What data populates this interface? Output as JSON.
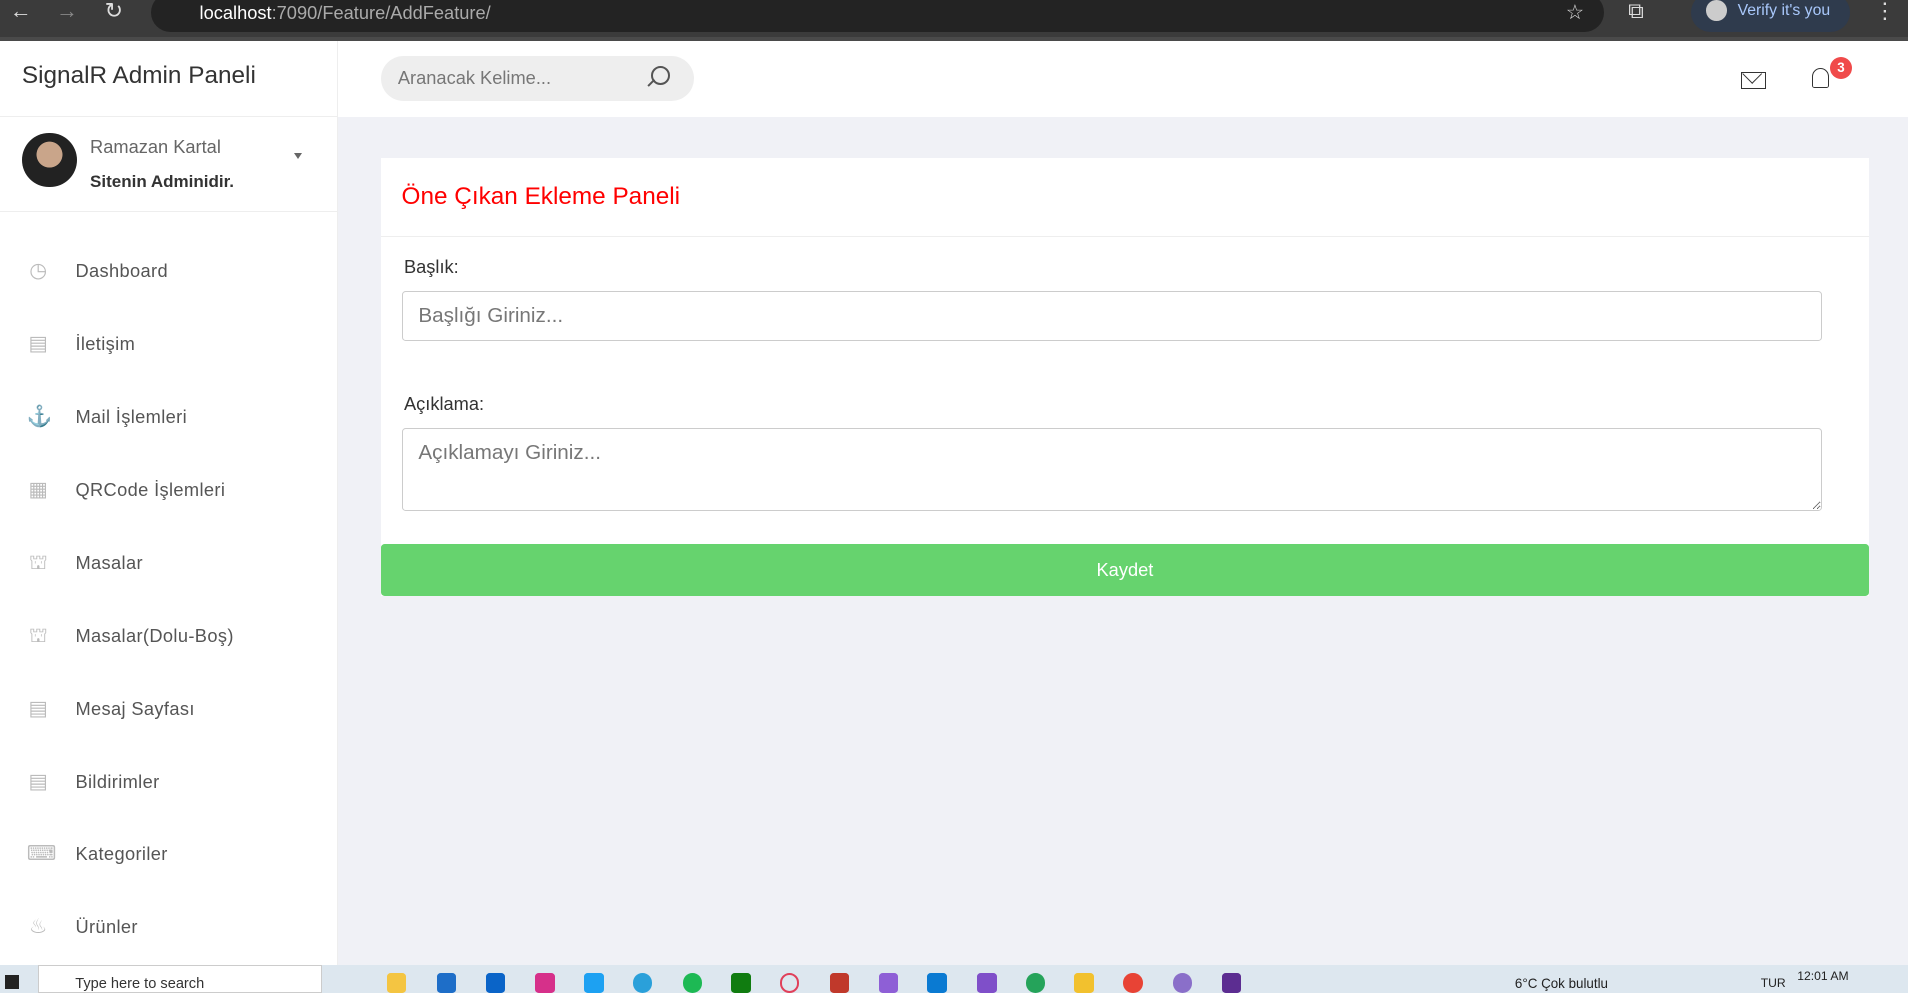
{
  "browser": {
    "url_host": "localhost",
    "url_path": ":7090/Feature/AddFeature/",
    "verify_label": "Verify it's you"
  },
  "sidebar": {
    "brand": "SignalR Admin Paneli",
    "user": {
      "name": "Ramazan Kartal",
      "role": "Sitenin Adminidir."
    },
    "items": [
      {
        "label": "Dashboard",
        "icon": "dashboard-icon"
      },
      {
        "label": "İletişim",
        "icon": "page-icon"
      },
      {
        "label": "Mail İşlemleri",
        "icon": "anchor-icon"
      },
      {
        "label": "QRCode İşlemleri",
        "icon": "qrcode-icon"
      },
      {
        "label": "Masalar",
        "icon": "table-icon"
      },
      {
        "label": "Masalar(Dolu-Boş)",
        "icon": "table-icon"
      },
      {
        "label": "Mesaj Sayfası",
        "icon": "page-icon"
      },
      {
        "label": "Bildirimler",
        "icon": "page-icon"
      },
      {
        "label": "Kategoriler",
        "icon": "keyboard-icon"
      },
      {
        "label": "Ürünler",
        "icon": "cake-icon"
      }
    ]
  },
  "header": {
    "search_placeholder": "Aranacak Kelime...",
    "notification_count": "3"
  },
  "form": {
    "title": "Öne Çıkan Ekleme Paneli",
    "title_label": "Başlık:",
    "title_placeholder": "Başlığı Giriniz...",
    "desc_label": "Açıklama:",
    "desc_placeholder": "Açıklamayı Giriniz...",
    "save_label": "Kaydet",
    "title_color": "#ff0000",
    "button_color": "#66d36e"
  },
  "taskbar": {
    "search_placeholder": "Type here to search",
    "weather": "6°C  Çok bulutlu",
    "language": "TUR",
    "time": "12:01 AM"
  }
}
